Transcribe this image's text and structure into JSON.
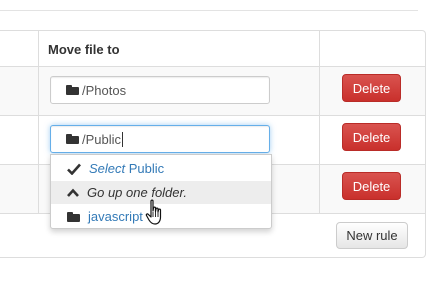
{
  "table": {
    "header": {
      "move_file_to": "Move file to"
    },
    "rows": [
      {
        "path": "/Photos",
        "delete_label": "Delete"
      },
      {
        "path": "/Public",
        "delete_label": "Delete"
      },
      {
        "delete_label": "Delete"
      }
    ],
    "new_rule_label": "New rule"
  },
  "dropdown": {
    "items": [
      {
        "prefix": "Select",
        "name": "Public",
        "icon": "check-icon"
      },
      {
        "label": "Go up one folder.",
        "icon": "chevron-up-icon",
        "active": true
      },
      {
        "label": "javascript",
        "icon": "folder-icon"
      }
    ]
  },
  "colors": {
    "danger": "#d9534f",
    "link": "#337ab7",
    "focus": "#66afe9",
    "stripe": "#f9f9f9",
    "border": "#dddddd"
  }
}
